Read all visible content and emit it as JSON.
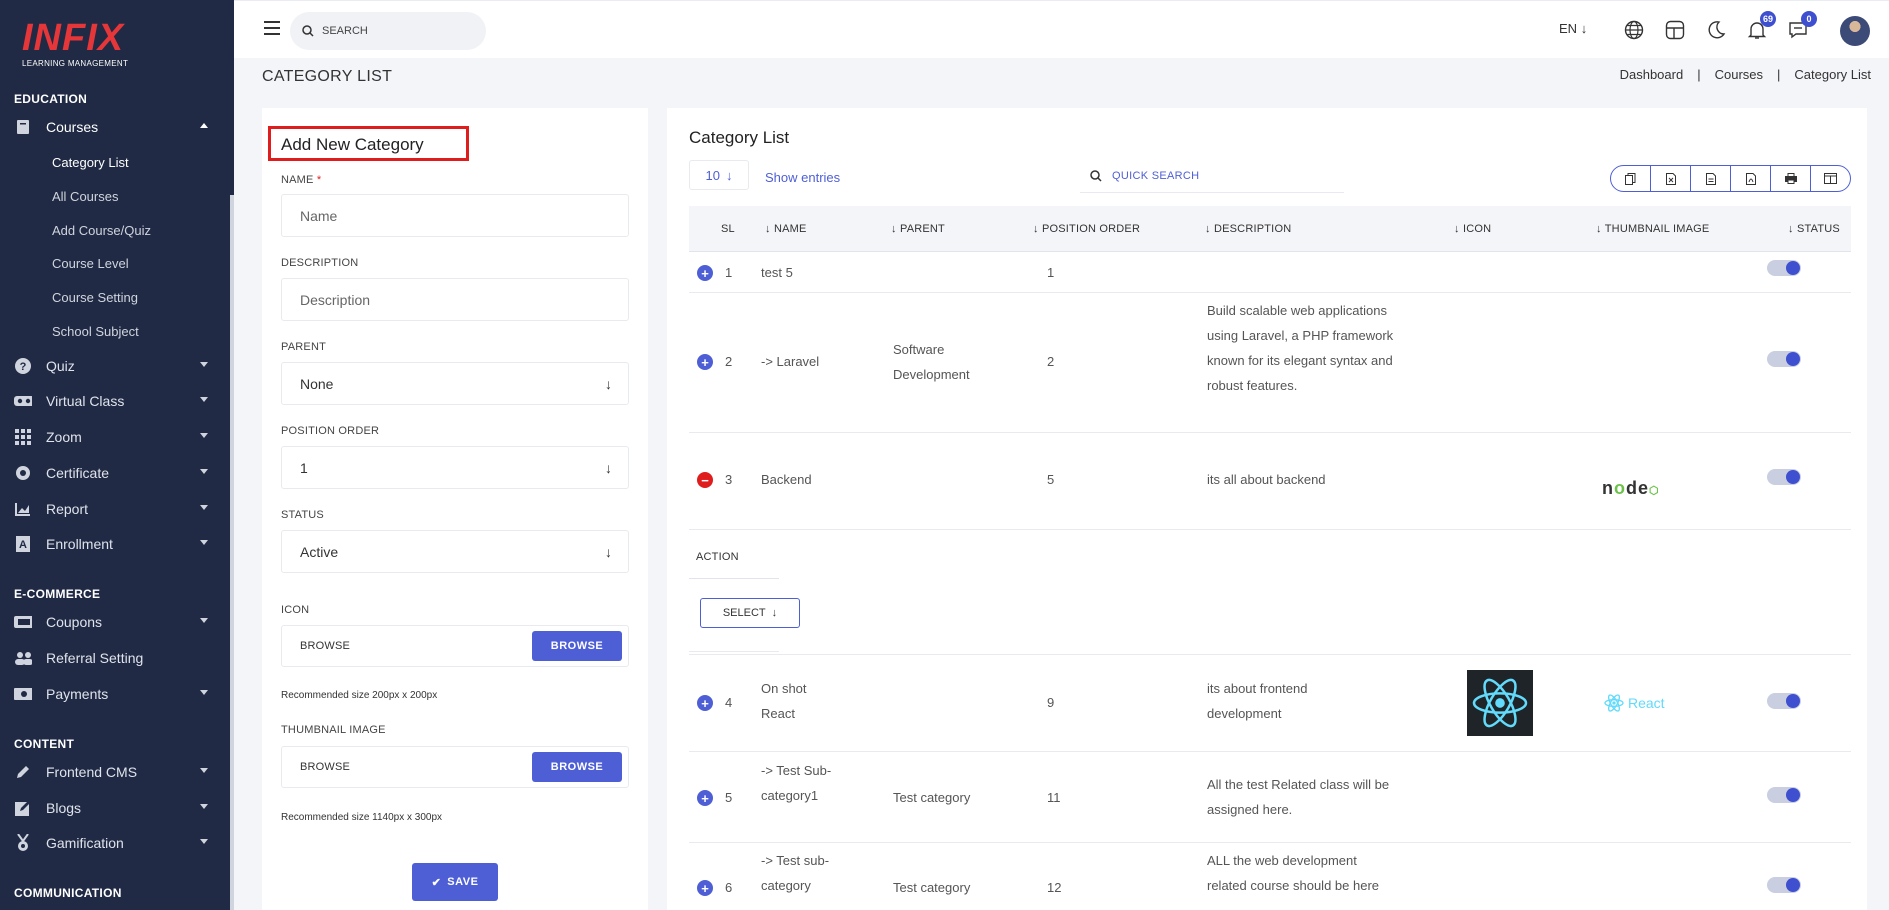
{
  "app": {
    "logo_main": "INFIX",
    "logo_sub": "LEARNING MANAGEMENT"
  },
  "sidebar": {
    "sections": [
      {
        "title": "EDUCATION"
      },
      {
        "title": "E-COMMERCE"
      },
      {
        "title": "CONTENT"
      },
      {
        "title": "COMMUNICATION"
      }
    ],
    "courses": {
      "label": "Courses"
    },
    "course_sub": [
      {
        "label": "Category List"
      },
      {
        "label": "All Courses"
      },
      {
        "label": "Add Course/Quiz"
      },
      {
        "label": "Course Level"
      },
      {
        "label": "Course Setting"
      },
      {
        "label": "School Subject"
      }
    ],
    "items": [
      {
        "label": "Quiz"
      },
      {
        "label": "Virtual Class"
      },
      {
        "label": "Zoom"
      },
      {
        "label": "Certificate"
      },
      {
        "label": "Report"
      },
      {
        "label": "Enrollment"
      },
      {
        "label": "Coupons"
      },
      {
        "label": "Referral Setting"
      },
      {
        "label": "Payments"
      },
      {
        "label": "Frontend CMS"
      },
      {
        "label": "Blogs"
      },
      {
        "label": "Gamification"
      }
    ]
  },
  "topbar": {
    "search_placeholder": "SEARCH",
    "language": "EN",
    "notifications_count": "69",
    "messages_count": "0"
  },
  "page": {
    "title": "CATEGORY LIST",
    "breadcrumb": [
      "Dashboard",
      "Courses",
      "Category List"
    ]
  },
  "form": {
    "title": "Add New Category",
    "name_label": "NAME",
    "name_required": "*",
    "name_placeholder": "Name",
    "description_label": "DESCRIPTION",
    "description_placeholder": "Description",
    "parent_label": "PARENT",
    "parent_value": "None",
    "position_label": "POSITION ORDER",
    "position_value": "1",
    "status_label": "STATUS",
    "status_value": "Active",
    "icon_label": "ICON",
    "icon_browse_text": "BROWSE",
    "icon_browse_btn": "BROWSE",
    "icon_hint": "Recommended size 200px x 200px",
    "thumb_label": "THUMBNAIL IMAGE",
    "thumb_browse_text": "BROWSE",
    "thumb_browse_btn": "BROWSE",
    "thumb_hint": "Recommended size 1140px x 300px",
    "save_label": "SAVE"
  },
  "list": {
    "title": "Category List",
    "entries_value": "10",
    "show_entries": "Show entries",
    "quick_search_placeholder": "QUICK SEARCH",
    "columns": [
      "SL",
      "NAME",
      "PARENT",
      "POSITION ORDER",
      "DESCRIPTION",
      "ICON",
      "THUMBNAIL IMAGE",
      "STATUS"
    ],
    "action_label": "ACTION",
    "select_label": "SELECT",
    "rows": [
      {
        "sl": "1",
        "name": "test 5",
        "parent": "",
        "position": "1",
        "description": ""
      },
      {
        "sl": "2",
        "name": "-> Laravel",
        "parent": "Software Development",
        "position": "2",
        "description": "Build scalable web applications using Laravel, a PHP framework known for its elegant syntax and robust features."
      },
      {
        "sl": "3",
        "name": "Backend",
        "parent": "",
        "position": "5",
        "description": "its all about backend",
        "thumbnail": "node"
      },
      {
        "sl": "4",
        "name": "On shot React",
        "parent": "",
        "position": "9",
        "description": "its about frontend development",
        "thumbnail": "React"
      },
      {
        "sl": "5",
        "name": "-> Test Sub-category1",
        "parent": "Test category",
        "position": "11",
        "description": "All the test Related class will be assigned here."
      },
      {
        "sl": "6",
        "name": "-> Test sub-category",
        "parent": "Test category",
        "position": "12",
        "description": "ALL the web development related course should be here"
      }
    ]
  }
}
